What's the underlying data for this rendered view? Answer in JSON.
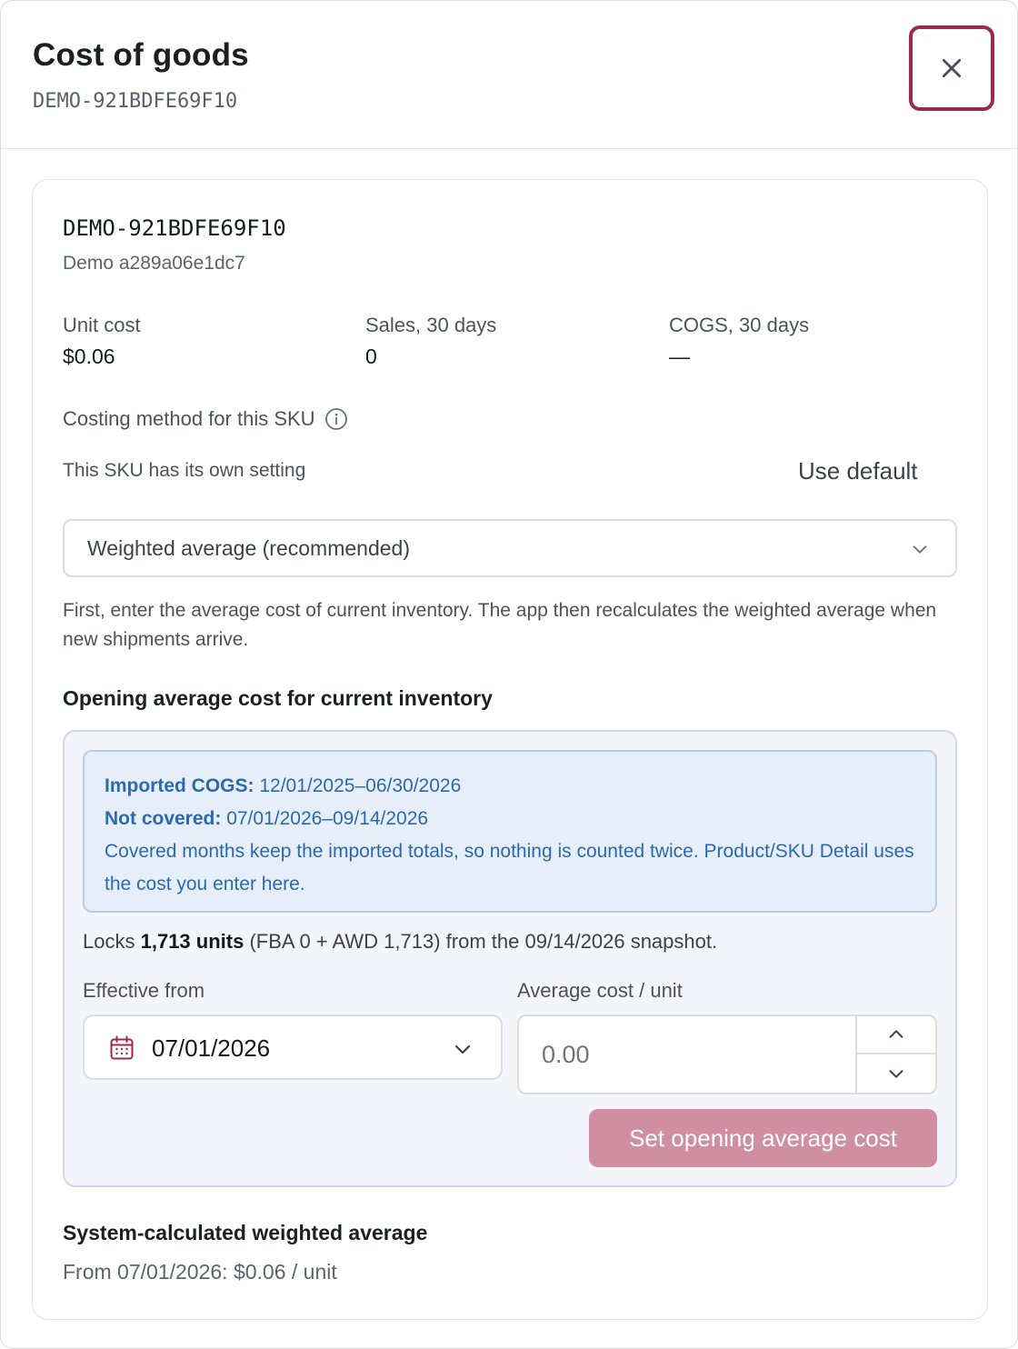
{
  "dialog": {
    "title": "Cost of goods",
    "subtitle": "DEMO-921BDFE69F10",
    "close_icon": "close-icon"
  },
  "product": {
    "sku": "DEMO-921BDFE69F10",
    "name": "Demo a289a06e1dc7"
  },
  "stats": [
    {
      "label": "Unit cost",
      "value": "$0.06"
    },
    {
      "label": "Sales, 30 days",
      "value": "0"
    },
    {
      "label": "COGS, 30 days",
      "value": "—"
    }
  ],
  "costing": {
    "label": "Costing method for this SKU",
    "info_icon": "info-icon",
    "own_setting_text": "This SKU has its own setting",
    "use_default_label": "Use default",
    "selected_method": "Weighted average (recommended)",
    "help_text": "First, enter the average cost of current inventory. The app then recalculates the weighted average when new shipments arrive."
  },
  "opening": {
    "title": "Opening average cost for current inventory",
    "notice": {
      "imported_label": "Imported COGS:",
      "imported_range": "12/01/2025–06/30/2026",
      "not_covered_label": "Not covered:",
      "not_covered_range": "07/01/2026–09/14/2026",
      "note": "Covered months keep the imported totals, so nothing is counted twice. Product/SKU Detail uses the cost you enter here."
    },
    "locks": {
      "prefix": "Locks",
      "units": "1,713 units",
      "suffix": "(FBA 0 + AWD 1,713) from the 09/14/2026 snapshot."
    },
    "effective_from_label": "Effective from",
    "effective_from_value": "07/01/2026",
    "avg_cost_label": "Average cost / unit",
    "avg_cost_placeholder": "0.00",
    "submit_label": "Set opening average cost"
  },
  "system": {
    "title": "System-calculated weighted average",
    "value": "From 07/01/2026: $0.06 / unit"
  },
  "colors": {
    "accent": "#9c2a50",
    "primary_disabled": "#d08ea3",
    "notice_text": "#2c6aab",
    "notice_bg": "#e6eef9"
  }
}
